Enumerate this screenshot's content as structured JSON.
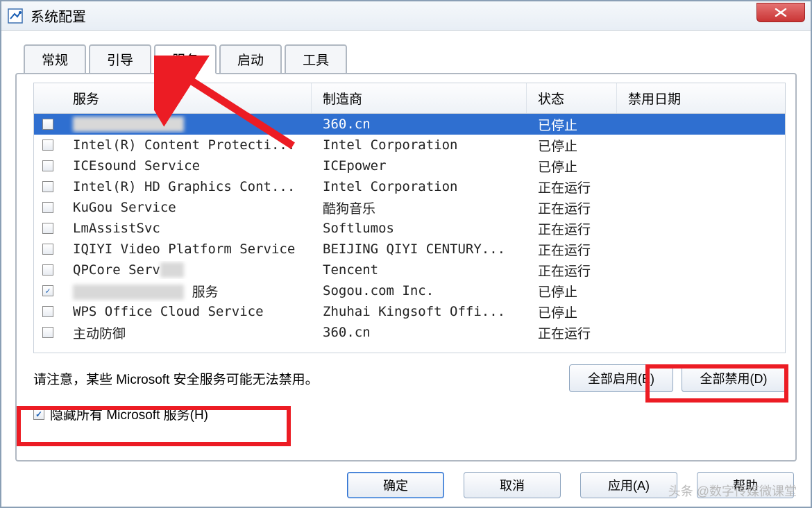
{
  "window": {
    "title": "系统配置"
  },
  "tabs": [
    {
      "label": "常规",
      "active": false
    },
    {
      "label": "引导",
      "active": false
    },
    {
      "label": "服务",
      "active": true
    },
    {
      "label": "启动",
      "active": false
    },
    {
      "label": "工具",
      "active": false
    }
  ],
  "columns": {
    "service": "服务",
    "manufacturer": "制造商",
    "status": "状态",
    "disabled_date": "禁用日期"
  },
  "rows": [
    {
      "checked": false,
      "service_blurred": true,
      "service": "",
      "manufacturer": "360.cn",
      "status": "已停止",
      "selected": true
    },
    {
      "checked": false,
      "service": "Intel(R) Content Protecti...",
      "manufacturer": "Intel Corporation",
      "status": "已停止"
    },
    {
      "checked": false,
      "service": "ICEsound Service",
      "manufacturer": "ICEpower",
      "status": "已停止"
    },
    {
      "checked": false,
      "service": "Intel(R) HD Graphics Cont...",
      "manufacturer": "Intel Corporation",
      "status": "正在运行"
    },
    {
      "checked": false,
      "service": "KuGou Service",
      "manufacturer": "酷狗音乐",
      "status": "正在运行"
    },
    {
      "checked": false,
      "service": "LmAssistSvc",
      "manufacturer": "Softlumos",
      "status": "正在运行"
    },
    {
      "checked": false,
      "service": "IQIYI Video Platform Service",
      "manufacturer": "BEIJING QIYI CENTURY...",
      "status": "正在运行"
    },
    {
      "checked": false,
      "service": "QPCore Service",
      "manufacturer": "Tencent",
      "status": "正在运行",
      "partial_blur": true
    },
    {
      "checked": true,
      "service_blurred": true,
      "service_suffix": "服务",
      "manufacturer": "Sogou.com Inc.",
      "status": "已停止"
    },
    {
      "checked": false,
      "service": "WPS Office Cloud Service",
      "manufacturer": "Zhuhai Kingsoft Offi...",
      "status": "已停止"
    },
    {
      "checked": false,
      "service": "主动防御",
      "manufacturer": "360.cn",
      "status": "正在运行"
    }
  ],
  "note": "请注意，某些 Microsoft 安全服务可能无法禁用。",
  "buttons": {
    "enable_all": "全部启用(E)",
    "disable_all": "全部禁用(D)"
  },
  "hide_ms": {
    "label": "隐藏所有 Microsoft 服务(H)",
    "checked": true
  },
  "dialog": {
    "ok": "确定",
    "cancel": "取消",
    "apply": "应用(A)",
    "help": "帮助"
  },
  "watermark": "头条 @数字传媒微课堂"
}
